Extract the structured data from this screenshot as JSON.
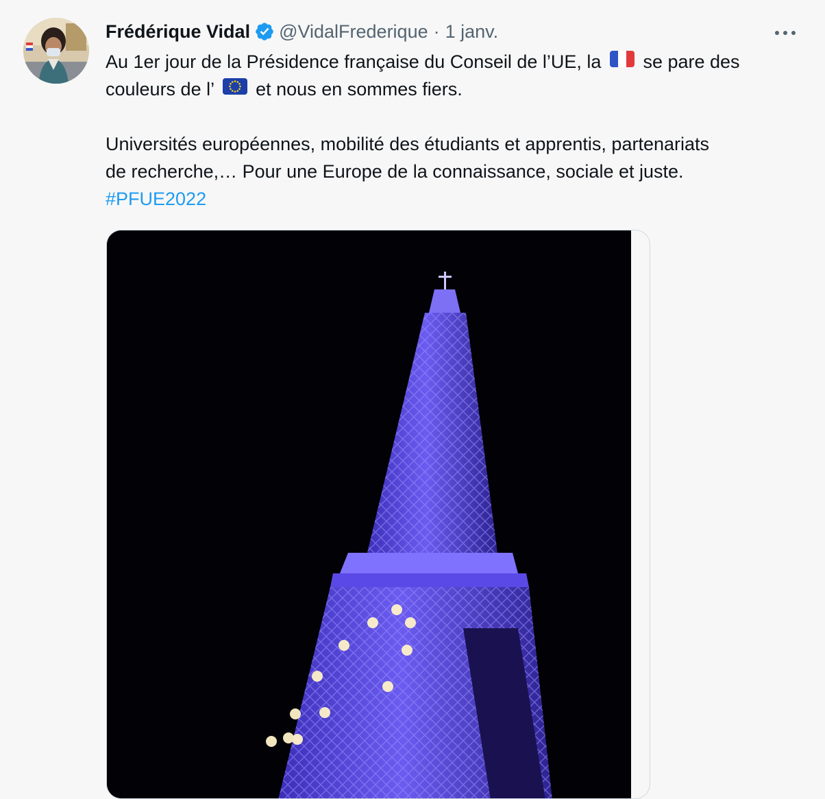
{
  "author": {
    "name": "Frédérique Vidal",
    "handle": "@VidalFrederique",
    "separator": "·",
    "date": "1 janv."
  },
  "tweet": {
    "line1_before_flag": "Au 1er jour de la Présidence française du Conseil de l’UE, la",
    "line1_after_flag": "se pare des",
    "line2_before_flag": "couleurs de l’",
    "line2_after_flag": "et nous en sommes fiers.",
    "line3": "Universités européennes, mobilité des étudiants et apprentis, partenariats",
    "line4": "de recherche,… Pour une Europe de la connaissance, sociale et juste.",
    "hashtag": "#PFUE2022"
  },
  "icons": {
    "verified": "verified-badge-icon",
    "more": "more-options-icon",
    "flag_fr": "france-flag-icon",
    "flag_eu": "eu-flag-icon"
  },
  "colors": {
    "accent": "#1d9bf0",
    "secondary_text": "#536471",
    "background": "#f7f7f7",
    "photo_background": "#020105",
    "tower_light": "#5a49e6"
  }
}
